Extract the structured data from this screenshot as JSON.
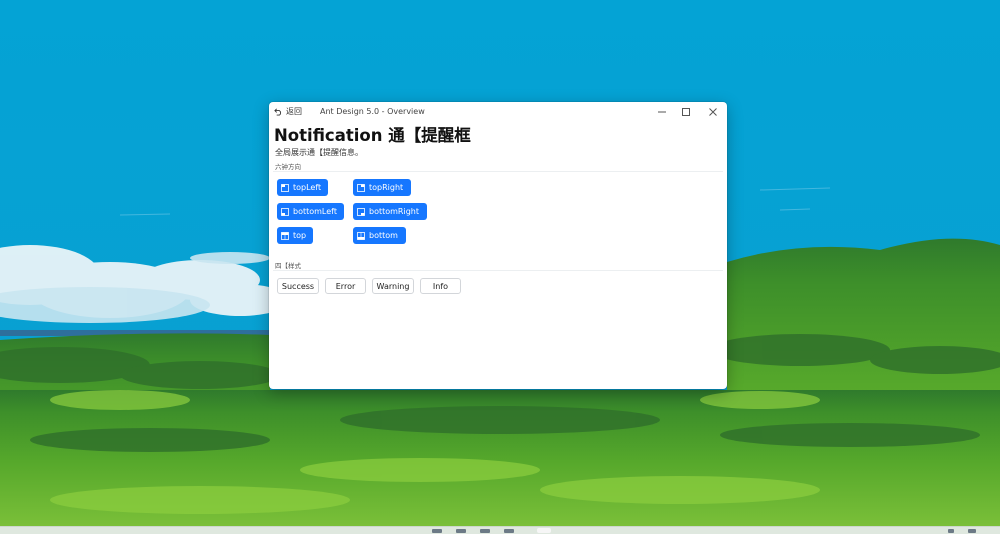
{
  "window": {
    "back_label": "返回",
    "title": "Ant Design 5.0 - Overview"
  },
  "page": {
    "title": "Notification 通【提醒框",
    "description": "全局展示通【提醒信息。"
  },
  "placement_section": {
    "label": "六钟方向",
    "buttons": [
      {
        "label": "topLeft",
        "icon": "placement-top-left-icon"
      },
      {
        "label": "topRight",
        "icon": "placement-top-right-icon"
      },
      {
        "label": "bottomLeft",
        "icon": "placement-bottom-left-icon"
      },
      {
        "label": "bottomRight",
        "icon": "placement-bottom-right-icon"
      },
      {
        "label": "top",
        "icon": "placement-top-icon"
      },
      {
        "label": "bottom",
        "icon": "placement-bottom-icon"
      }
    ]
  },
  "type_section": {
    "label": "四【样式",
    "buttons": [
      {
        "label": "Success"
      },
      {
        "label": "Error"
      },
      {
        "label": "Warning"
      },
      {
        "label": "Info"
      }
    ]
  },
  "colors": {
    "primary": "#1677ff",
    "desktop_sky": "#05a0d2",
    "grass": "#4f9a2c"
  }
}
